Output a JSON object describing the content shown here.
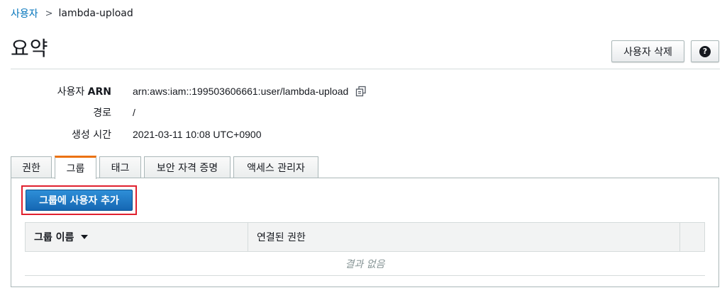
{
  "breadcrumb": {
    "parent": "사용자",
    "separator": ">",
    "current": "lambda-upload"
  },
  "page": {
    "title": "요약"
  },
  "header_actions": {
    "delete_user": "사용자 삭제",
    "help": "?"
  },
  "summary": {
    "arn_label_prefix": "사용자 ",
    "arn_label_bold": "ARN",
    "arn_value": "arn:aws:iam::199503606661:user/lambda-upload",
    "path_label": "경로",
    "path_value": "/",
    "created_label": "생성 시간",
    "created_value": "2021-03-11 10:08 UTC+0900"
  },
  "tabs": [
    {
      "label": "권한",
      "active": false
    },
    {
      "label": "그룹",
      "active": true
    },
    {
      "label": "태그",
      "active": false
    },
    {
      "label": "보안 자격 증명",
      "active": false
    },
    {
      "label": "액세스 관리자",
      "active": false
    }
  ],
  "groups_panel": {
    "add_button": "그룹에 사용자 추가",
    "columns": [
      "그룹 이름",
      "연결된 권한"
    ],
    "empty_message": "결과 없음"
  },
  "colors": {
    "link": "#0073bb",
    "active_tab_accent": "#ec7211",
    "primary_button": "#1a73c4",
    "highlight": "#e0202e"
  },
  "icons": {
    "copy": "copy-icon",
    "help": "help-icon",
    "sort": "sort-down-icon",
    "breadcrumb_separator": "chevron-right-icon"
  }
}
